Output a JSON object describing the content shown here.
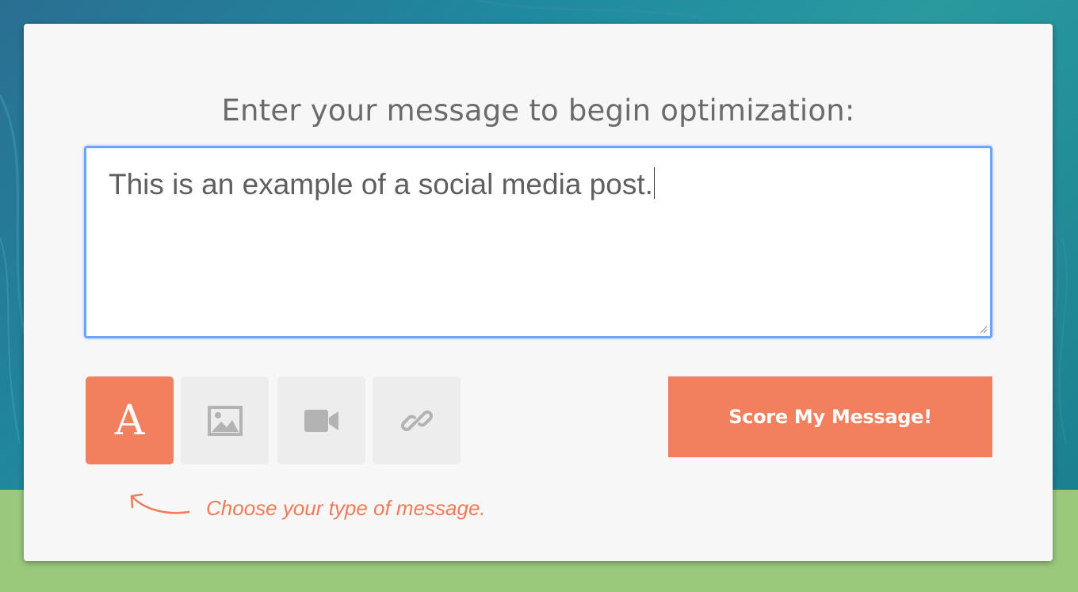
{
  "form": {
    "heading": "Enter your message to begin optimization:",
    "message_value": "This is an example of a social media post.",
    "hint": "Choose your type of message."
  },
  "message_types": [
    {
      "label": "A",
      "icon": "text-icon",
      "selected": true
    },
    {
      "icon": "image-icon",
      "selected": false
    },
    {
      "icon": "video-icon",
      "selected": false
    },
    {
      "icon": "link-icon",
      "selected": false
    }
  ],
  "actions": {
    "score_label": "Score My Message!"
  },
  "colors": {
    "accent": "#f2805f",
    "focus_border": "#6ea3f5",
    "card_bg": "#f7f7f7",
    "button_inactive": "#ededed",
    "icon_gray": "#b3b3b3",
    "background_teal": "#1f8aa0",
    "background_green": "#9ac97c"
  }
}
